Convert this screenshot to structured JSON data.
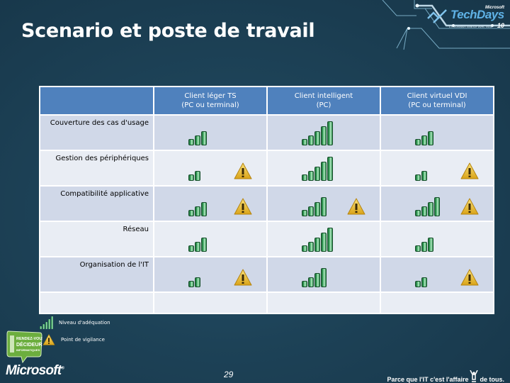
{
  "slide": {
    "title": "Scenario et poste de travail",
    "page_number": "29"
  },
  "branding": {
    "event_logo": {
      "brand": "Microsoft",
      "name": "TechDays",
      "tagline": "L'innovation avance avec vous",
      "year": "10"
    },
    "badge": {
      "line1": "RENDEZ-VOUS",
      "line2": "DÉCIDEURS",
      "line3": "INFORMATIQUES"
    },
    "company_logo": "Microsoft",
    "footer_tagline_before": "Parce que l'IT c'est l'affaire",
    "footer_tagline_after": "de tous."
  },
  "matrix": {
    "columns": [
      {
        "label_line1": "Client léger TS",
        "label_line2": "(PC ou terminal)"
      },
      {
        "label_line1": "Client intelligent",
        "label_line2": "(PC)"
      },
      {
        "label_line1": "Client virtuel VDI",
        "label_line2": "(PC ou terminal)"
      }
    ],
    "rows": [
      {
        "label": "Couverture des cas d'usage",
        "cells": [
          {
            "level": 3,
            "warning": false
          },
          {
            "level": 5,
            "warning": false
          },
          {
            "level": 3,
            "warning": false
          }
        ]
      },
      {
        "label": "Gestion des périphériques",
        "cells": [
          {
            "level": 2,
            "warning": true
          },
          {
            "level": 5,
            "warning": false
          },
          {
            "level": 2,
            "warning": true
          }
        ]
      },
      {
        "label": "Compatibilité applicative",
        "cells": [
          {
            "level": 3,
            "warning": true
          },
          {
            "level": 4,
            "warning": true
          },
          {
            "level": 4,
            "warning": true
          }
        ]
      },
      {
        "label": "Réseau",
        "cells": [
          {
            "level": 3,
            "warning": false
          },
          {
            "level": 5,
            "warning": false
          },
          {
            "level": 3,
            "warning": false
          }
        ]
      },
      {
        "label": "Organisation de l'IT",
        "cells": [
          {
            "level": 2,
            "warning": true
          },
          {
            "level": 4,
            "warning": false
          },
          {
            "level": 2,
            "warning": true
          }
        ]
      },
      {
        "label": "",
        "cells": [
          {
            "level": 0,
            "warning": false
          },
          {
            "level": 0,
            "warning": false
          },
          {
            "level": 0,
            "warning": false
          }
        ]
      }
    ],
    "max_level": 5
  },
  "legend": {
    "items": [
      {
        "icon": "signal-bars-icon",
        "label": "Niveau d'adéquation"
      },
      {
        "icon": "warning-icon",
        "label": "Point de vigilance"
      }
    ]
  },
  "colors": {
    "header_bg": "#4f81bd",
    "row_odd": "#d0d8e8",
    "row_even": "#e9edf4",
    "bar_green": "#3ea860",
    "warning_yellow": "#f2c230"
  }
}
